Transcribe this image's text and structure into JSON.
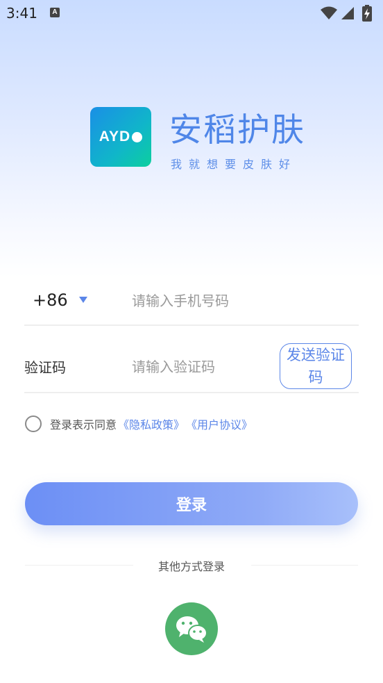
{
  "status_bar": {
    "time": "3:41",
    "notification_icon": "a-icon",
    "wifi_icon": "wifi-icon",
    "signal_icon": "signal-icon",
    "battery_icon": "battery-charging-icon"
  },
  "brand": {
    "logo_text": "AYD",
    "name": "安稻护肤",
    "slogan": "我就想要皮肤好"
  },
  "form": {
    "country_code": "+86",
    "phone_placeholder": "请输入手机号码",
    "code_label": "验证码",
    "code_placeholder": "请输入验证码",
    "send_code_label": "发送验证码"
  },
  "agreement": {
    "text": "登录表示同意",
    "privacy_link": "《隐私政策》",
    "user_link": "《用户协议》"
  },
  "login_button": "登录",
  "other_login": {
    "label": "其他方式登录",
    "wechat_icon": "wechat-icon"
  },
  "colors": {
    "accent": "#5b86e8",
    "brand": "#4f86e8",
    "wechat": "#4fb26d"
  }
}
